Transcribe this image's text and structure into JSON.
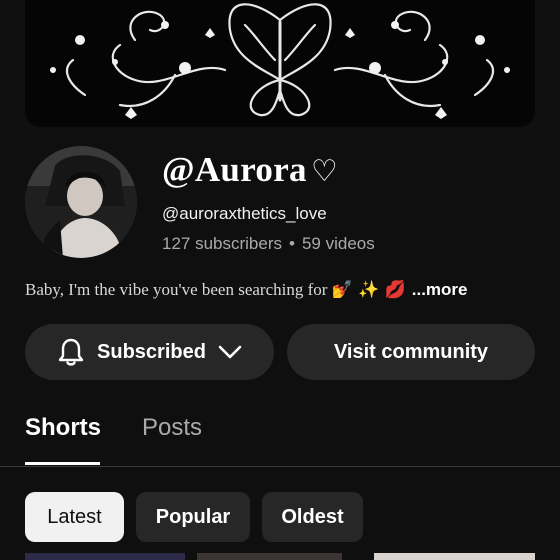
{
  "banner": {
    "icon": "butterfly-art"
  },
  "channel": {
    "name": "@Aurora",
    "name_symbol": "♡",
    "handle": "@auroraxthetics_love",
    "subscribers": "127 subscribers",
    "separator": "•",
    "videos": "59 videos",
    "description": "Baby, I'm the vibe you've been searching for",
    "description_emojis": "💅 ✨ 💋",
    "more_label": "...more"
  },
  "actions": {
    "subscribed_label": "Subscribed",
    "community_label": "Visit community"
  },
  "tabs": [
    {
      "label": "Shorts",
      "active": true
    },
    {
      "label": "Posts",
      "active": false
    }
  ],
  "filters": [
    {
      "label": "Latest",
      "selected": true
    },
    {
      "label": "Popular",
      "selected": false
    },
    {
      "label": "Oldest",
      "selected": false
    }
  ],
  "colors": {
    "background": "#0f0f0f",
    "button_bg": "#272727",
    "secondary_text": "#aaaaaa"
  }
}
